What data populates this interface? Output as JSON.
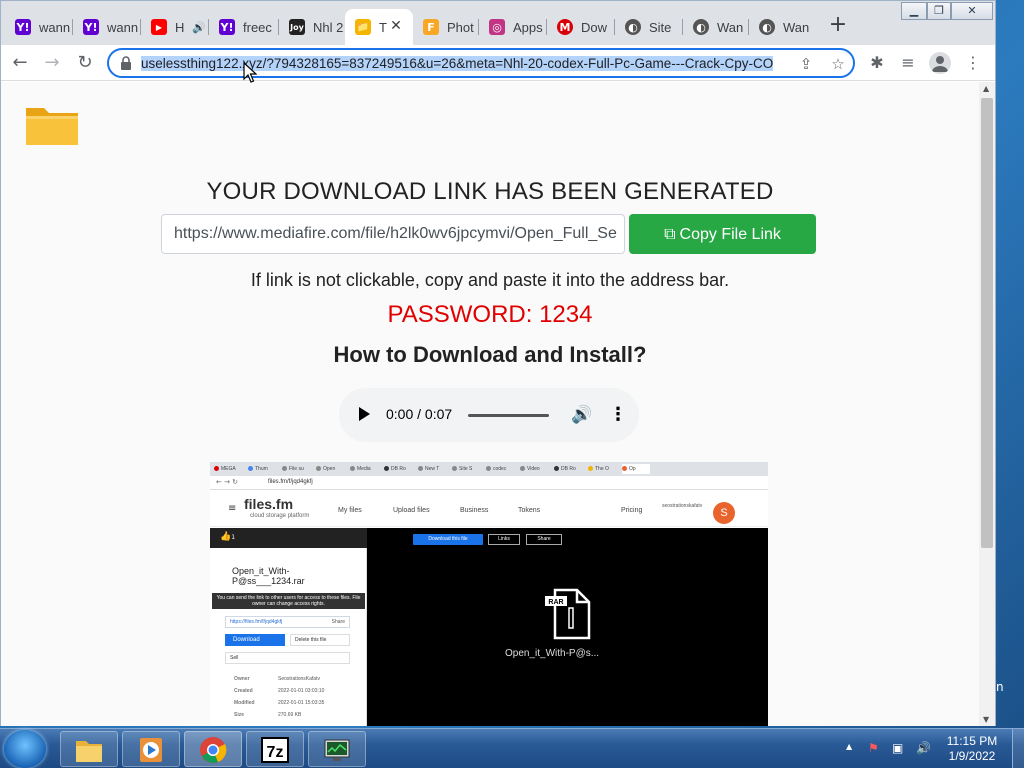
{
  "tabs": [
    {
      "label": "wann",
      "favicon": "Y!",
      "color": "#6001d2"
    },
    {
      "label": "wann",
      "favicon": "Y!",
      "color": "#6001d2"
    },
    {
      "label": "H",
      "favicon": "▶",
      "color": "#ff0000",
      "audio": "🔊"
    },
    {
      "label": "freec",
      "favicon": "Y!",
      "color": "#6001d2"
    },
    {
      "label": "Nhl 2",
      "favicon": "Joy",
      "color": "#222222"
    },
    {
      "label": "T",
      "favicon": "📁",
      "color": "#f4b400",
      "active": true
    },
    {
      "label": "Phot",
      "favicon": "F",
      "color": "#f9a825"
    },
    {
      "label": "Apps",
      "favicon": "◎",
      "color": "#c13584"
    },
    {
      "label": "Dow",
      "favicon": "M",
      "color": "#d90007"
    },
    {
      "label": "Site",
      "favicon": "◐",
      "color": "#555555"
    },
    {
      "label": "Wan",
      "favicon": "◐",
      "color": "#555555"
    },
    {
      "label": "Wan",
      "favicon": "◐",
      "color": "#555555"
    }
  ],
  "active_tab_close": "✕",
  "new_tab_label": "+",
  "window_controls": {
    "minimize": "▁",
    "restore": "❐",
    "close": "✕"
  },
  "toolbar": {
    "back": "←",
    "forward": "→",
    "reload": "↻",
    "url": "uselessthing122.xyz/?794328165=837249516&u=26&meta=Nhl-20-codex-Full-Pc-Game---Crack-Cpy-CO",
    "share_icon": "⇪",
    "bookmark_icon": "☆",
    "extensions_icon": "✱",
    "media_icon": "≡",
    "menu_icon": "⋮"
  },
  "page": {
    "heading": "YOUR DOWNLOAD LINK HAS BEEN GENERATED",
    "link_value": "https://www.mediafire.com/file/h2lk0wv6jpcymvi/Open_Full_Se",
    "copy_button_label": "Copy File Link",
    "copy_icon": "⧉",
    "hint": "If link is not clickable, copy and paste it into the address bar.",
    "password": "PASSWORD: 1234",
    "howto_heading": "How to Download and Install?",
    "audio": {
      "time": "0:00 / 0:07",
      "progress": 0.0
    }
  },
  "tutorial": {
    "tabs": [
      "MEGA",
      "Thum",
      "File su",
      "Open",
      "Media",
      "DB Ro",
      "New T",
      "Site S",
      "codec",
      "Video",
      "DB Ro",
      "The O",
      "Op"
    ],
    "url": "files.fm/f/jqd4gkfj",
    "logo": "files.fm",
    "logo_sub": "cloud storage platform",
    "nav": [
      "My files",
      "Upload files",
      "Business",
      "Tokens",
      "Pricing"
    ],
    "username": "seostrationskafatv",
    "avatar_letter": "S",
    "like_count": "1",
    "file_name": "Open_it_With-P@ss___1234.rar",
    "tooltip": "You can send the link to other users for access to these files. File owner can change access rights.",
    "link_box": "https://files.fm/f/jqd4gkfj",
    "share_small": "Share",
    "download_btn": "Download",
    "delete_btn": "Delete this file",
    "sell_btn": "Sell",
    "meta": [
      {
        "label": "Owner",
        "value": "SeostrationsKafatv"
      },
      {
        "label": "Created",
        "value": "2022-01-01 03:03:10"
      },
      {
        "label": "Modified",
        "value": "2022-01-01 15:03:35"
      },
      {
        "label": "Size",
        "value": "270.69 KB"
      }
    ],
    "download_this_file": "Download this file",
    "links_btn": "Links",
    "share_btn": "Share",
    "preview_name": "Open_it_With-P@s...",
    "rar_label": "RAR"
  },
  "taskbar": {
    "time": "11:15 PM",
    "date": "1/9/2022",
    "tray_up": "▲",
    "tray_icons": [
      "⚑",
      "▣",
      "🔊"
    ]
  },
  "desktop_sliver": "n"
}
